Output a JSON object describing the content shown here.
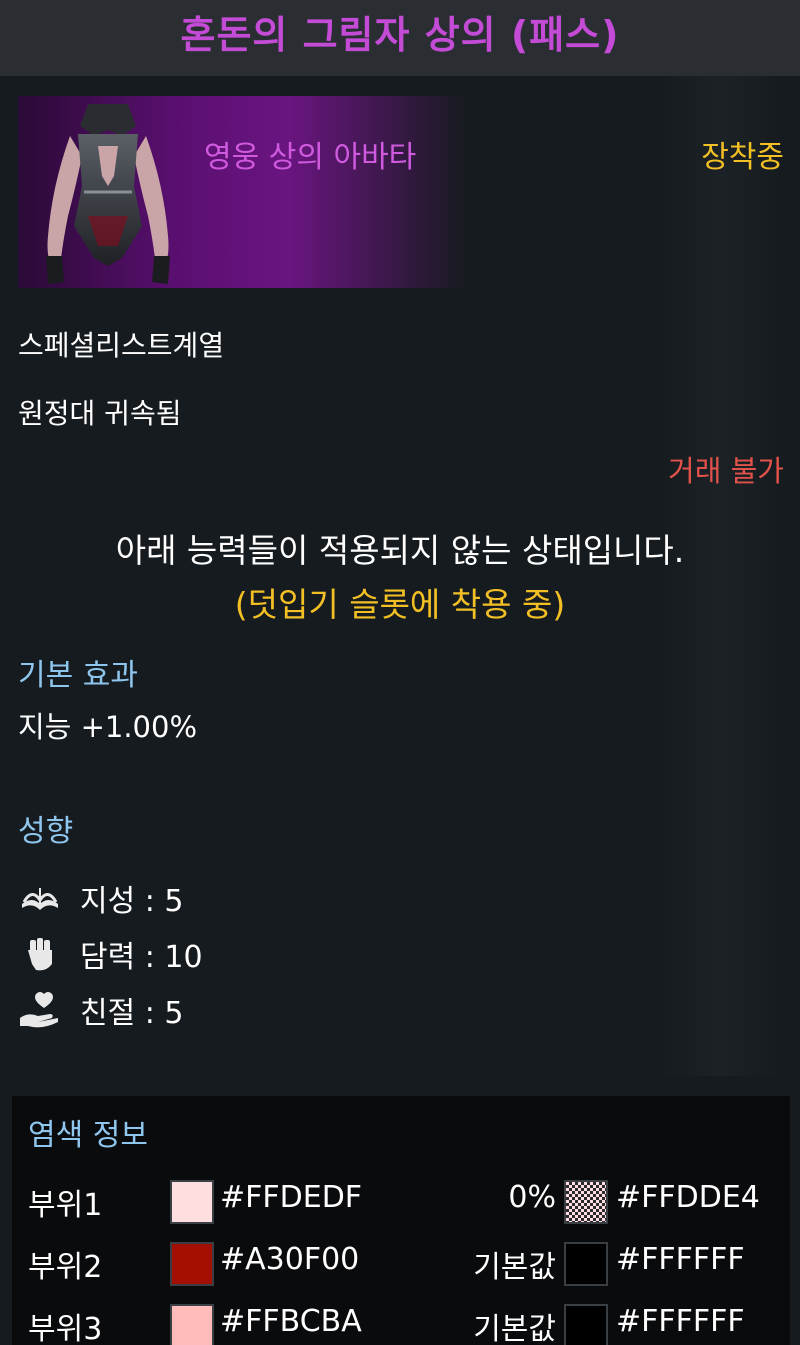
{
  "title": "혼돈의 그림자 상의 (패스)",
  "item": {
    "type_label": "영웅 상의 아바타",
    "equipped_label": "장착중",
    "class_restriction": "스페셜리스트계열",
    "binding": "원정대 귀속됨",
    "trade": "거래 불가"
  },
  "notice": {
    "line1": "아래 능력들이 적용되지 않는 상태입니다.",
    "line2": "(덧입기 슬롯에 착용 중)"
  },
  "base_effect": {
    "heading": "기본 효과",
    "value": "지능 +1.00%"
  },
  "traits": {
    "heading": "성향",
    "items": [
      {
        "icon": "book-icon",
        "text": "지성 : 5"
      },
      {
        "icon": "fist-icon",
        "text": "담력 : 10"
      },
      {
        "icon": "heart-hand-icon",
        "text": "친절 : 5"
      }
    ]
  },
  "dye": {
    "heading": "염색 정보",
    "rows": [
      {
        "part": "부위1",
        "color1": "#FFDEDF",
        "hex1": "#FFDEDF",
        "modifier": "0%",
        "color2": "#FFDDE4",
        "hex2": "#FFDDE4"
      },
      {
        "part": "부위2",
        "color1": "#A30F00",
        "hex1": "#A30F00",
        "modifier": "기본값",
        "color2": "#000000",
        "hex2": "#FFFFFF"
      },
      {
        "part": "부위3",
        "color1": "#FFBCBA",
        "hex1": "#FFBCBA",
        "modifier": "기본값",
        "color2": "#000000",
        "hex2": "#FFFFFF"
      }
    ]
  },
  "colors": {
    "title": "#c44bd6",
    "hero_grade": "#d05adf",
    "equipped": "#f2c025",
    "untradable": "#e0524a",
    "section_heading": "#8fc6ee"
  }
}
